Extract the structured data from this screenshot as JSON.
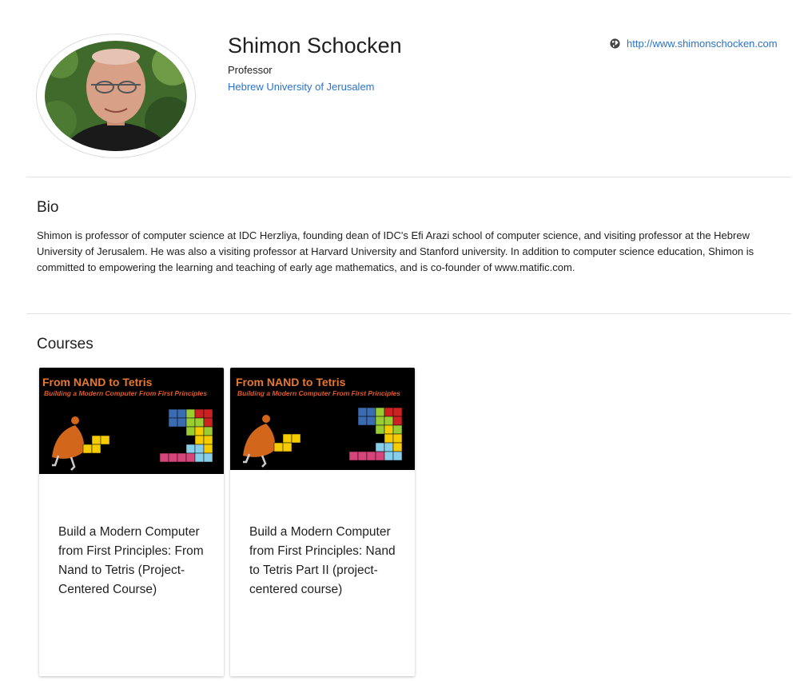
{
  "profile": {
    "name": "Shimon Schocken",
    "title": "Professor",
    "affiliation": "Hebrew University of Jerusalem",
    "website": "http://www.shimonschocken.com"
  },
  "bio": {
    "heading": "Bio",
    "text": "Shimon is professor of computer science at IDC Herzliya, founding dean of IDC's Efi Arazi school of computer science, and visiting professor at the Hebrew University of Jerusalem. He was also a visiting professor at Harvard University and Stanford university. In addition to computer science education, Shimon is committed to empowering the learning and teaching of early age mathematics, and is co-founder of www.matific.com."
  },
  "courses": {
    "heading": "Courses",
    "items": [
      {
        "image_title": "From NAND to Tetris",
        "image_subtitle": "Building a Modern Computer From First Principles",
        "title": "Build a Modern Computer from First Principles: From Nand to Tetris (Project-Centered Course)"
      },
      {
        "image_title": "From NAND to Tetris",
        "image_subtitle": "Building a Modern Computer From First Principles",
        "title": "Build a Modern Computer from First Principles: Nand to Tetris Part II (project-centered course)"
      }
    ]
  },
  "icons": {
    "website": "globe-icon"
  },
  "colors": {
    "link": "#2a73cc",
    "card_image_bg": "#000000",
    "image_title": "#e7782e"
  }
}
